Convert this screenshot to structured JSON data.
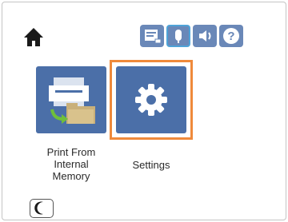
{
  "header": {
    "icons": [
      {
        "name": "home-icon"
      },
      {
        "name": "network-status-icon"
      },
      {
        "name": "voice-mic-icon"
      },
      {
        "name": "volume-icon"
      },
      {
        "name": "help-icon"
      }
    ]
  },
  "tiles": [
    {
      "label": "Print From\nInternal\nMemory",
      "icon": "print-from-memory-icon"
    },
    {
      "label": "Settings",
      "icon": "gear-icon",
      "selected": true
    }
  ],
  "footer": {
    "sleep_icon": "moon-icon"
  },
  "colors": {
    "tile_blue": "#4b6fa8",
    "status_blue": "#6a88b8",
    "selection_orange": "#ef8a3b",
    "folder_tan": "#c9b07a",
    "arrow_green": "#6fbf3a"
  }
}
